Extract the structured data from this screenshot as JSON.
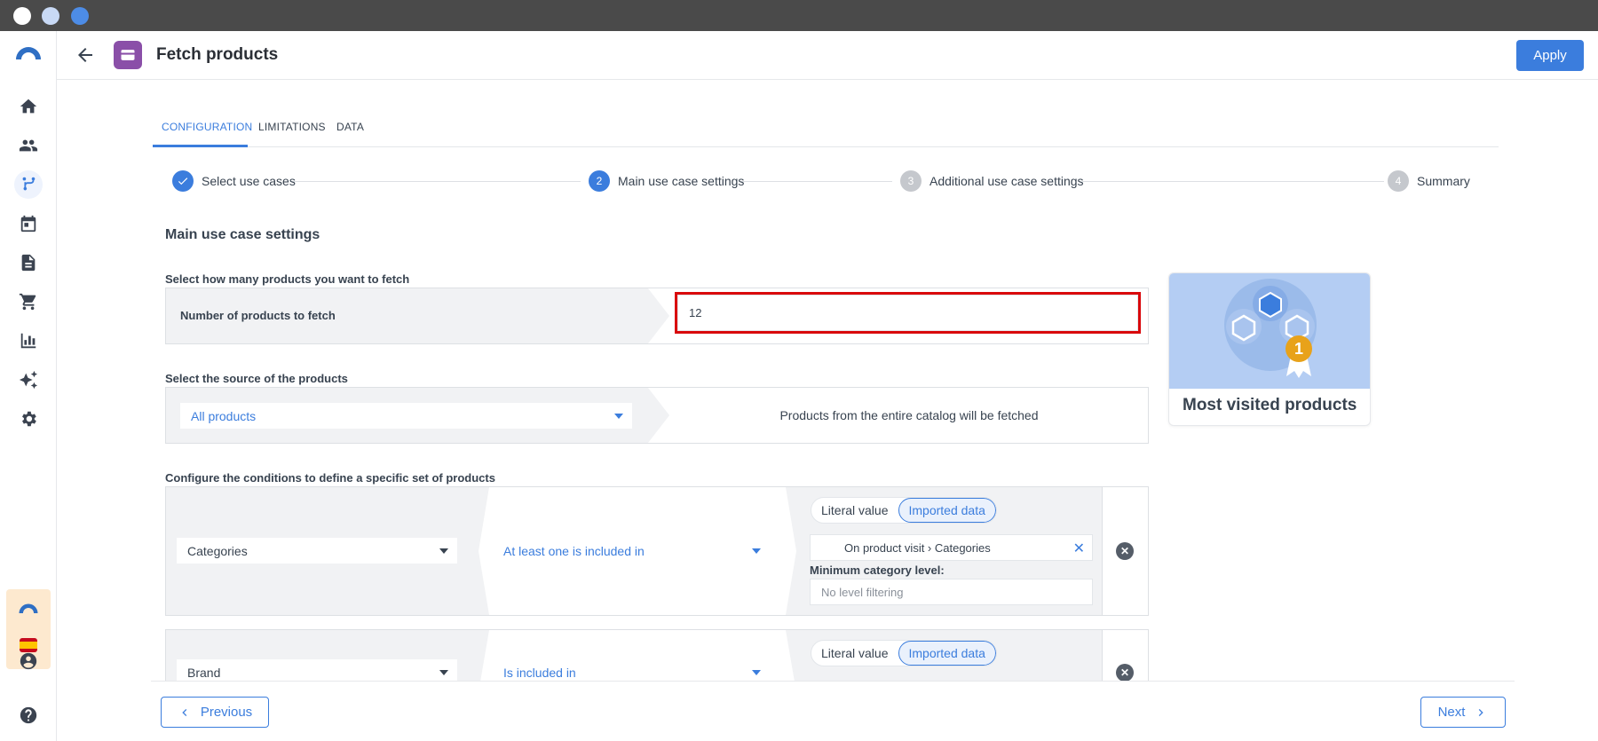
{
  "window": {
    "dots": [
      "#ffffff",
      "#c8d9f5",
      "#4d8ce6"
    ]
  },
  "header": {
    "title": "Fetch products",
    "apply_label": "Apply"
  },
  "tabs": [
    "CONFIGURATION",
    "LIMITATIONS",
    "DATA"
  ],
  "stepper": [
    {
      "label": "Select use cases",
      "state": "done"
    },
    {
      "num": "2",
      "label": "Main use case settings",
      "state": "active"
    },
    {
      "num": "3",
      "label": "Additional use case settings",
      "state": "pending"
    },
    {
      "num": "4",
      "label": "Summary",
      "state": "pending"
    }
  ],
  "main": {
    "section_title": "Main use case settings",
    "count": {
      "label": "Select how many products you want to fetch",
      "field_label": "Number of products to fetch",
      "value": "12"
    },
    "source": {
      "label": "Select the source of the products",
      "selected": "All products",
      "description": "Products from the entire catalog will be fetched"
    },
    "conditions": {
      "label": "Configure the conditions to define a specific set of products",
      "toggle": {
        "literal": "Literal value",
        "imported": "Imported data"
      },
      "rows": [
        {
          "attribute": "Categories",
          "operator": "At least one is included in",
          "value": "On product visit › Categories",
          "min_level_label": "Minimum category level:",
          "min_level_placeholder": "No level filtering"
        },
        {
          "attribute": "Brand",
          "operator": "Is included in"
        }
      ]
    }
  },
  "card": {
    "title": "Most visited products",
    "badge": "1"
  },
  "footer": {
    "previous": "Previous",
    "next": "Next"
  },
  "colors": {
    "accent": "#3b7ddd",
    "highlight": "#d9080b",
    "app_icon": "#8a4fa8"
  }
}
